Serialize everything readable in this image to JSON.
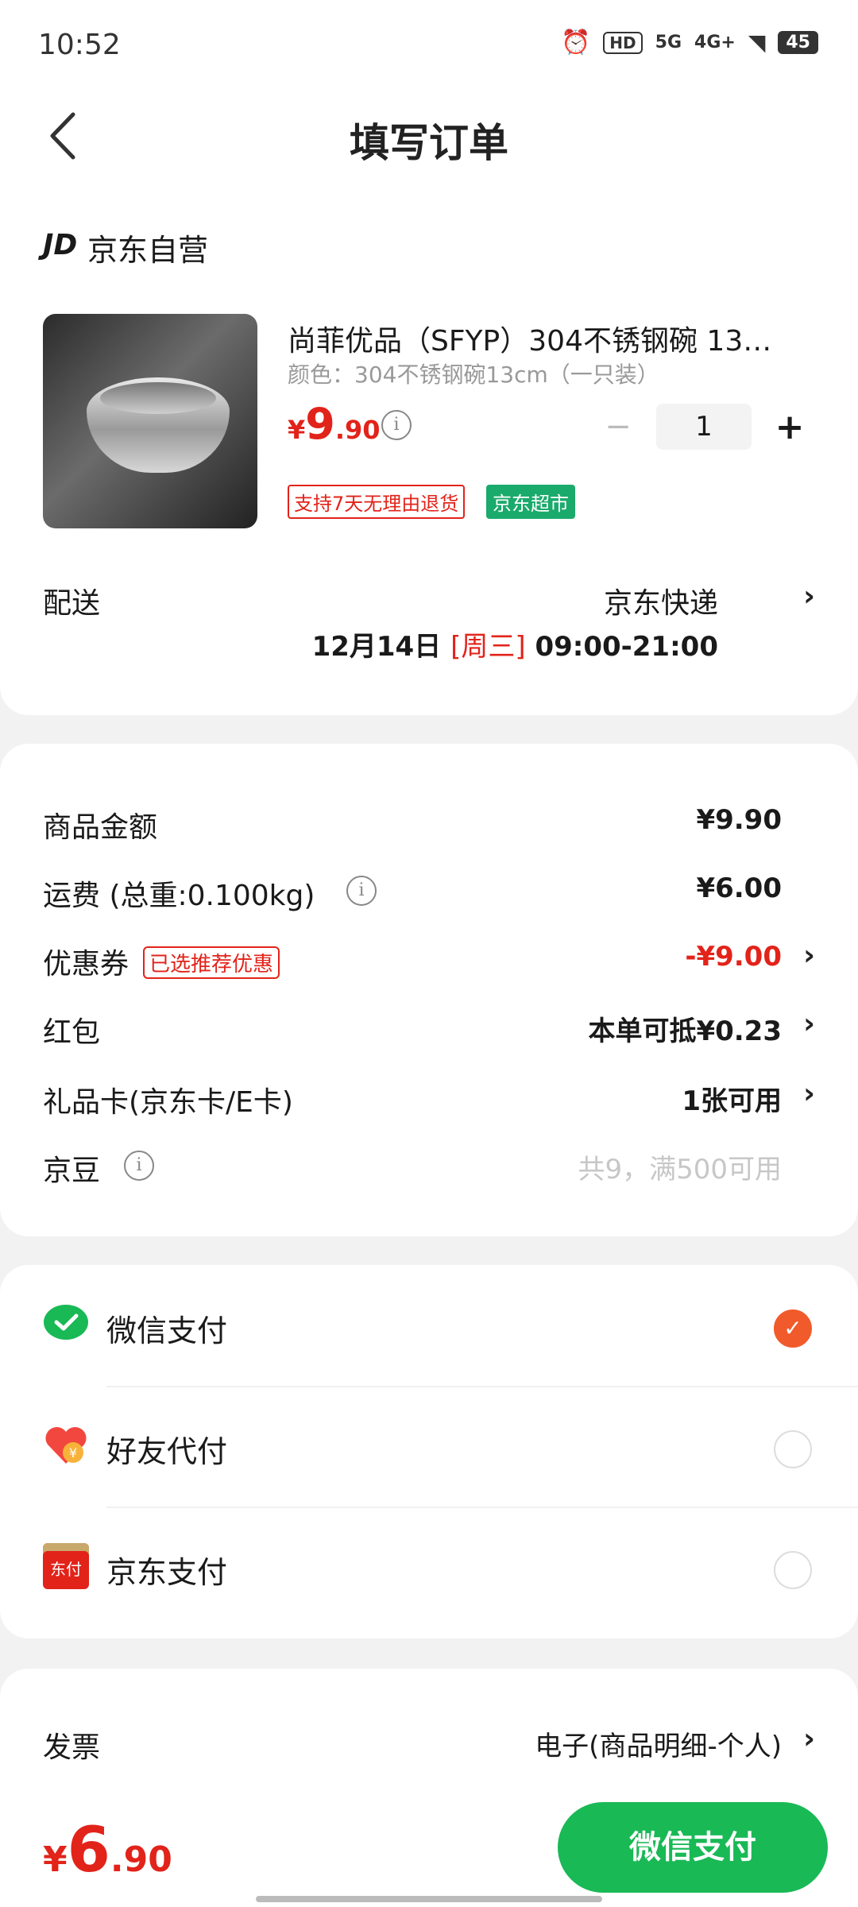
{
  "status_bar": {
    "time": "10:52",
    "hd": "HD",
    "sig1": "5G",
    "sig2": "4G+",
    "battery": "45"
  },
  "header": {
    "title": "填写订单"
  },
  "store": {
    "logo": "JD",
    "name": "京东自营"
  },
  "product": {
    "name": "尚菲优品（SFYP）304不锈钢碗 13…",
    "spec": "颜色：304不锈钢碗13cm（一只装）",
    "price_symbol": "¥",
    "price_int": "9",
    "price_dec": ".90",
    "quantity": "1",
    "minus": "−",
    "plus": "+",
    "tags": [
      "支持7天无理由退货",
      "京东超市"
    ]
  },
  "shipping": {
    "label": "配送",
    "company": "京东快递",
    "date": "12月14日",
    "weekday": "[周三]",
    "time": "09:00-21:00"
  },
  "summary": [
    {
      "label": "商品金额",
      "value": "¥9.90"
    },
    {
      "label": "运费  (总重:0.100kg)",
      "value": "¥6.00"
    },
    {
      "label": "优惠券",
      "tag": "已选推荐优惠",
      "value": "-¥9.00"
    },
    {
      "label": "红包",
      "value": "本单可抵¥0.23"
    },
    {
      "label": "礼品卡(京东卡/E卡)",
      "value": "1张可用"
    },
    {
      "label": "京豆",
      "value": "共9，满500可用"
    }
  ],
  "payment": {
    "options": [
      {
        "label": "微信支付",
        "selected": true
      },
      {
        "label": "好友代付",
        "selected": false
      },
      {
        "label": "京东支付",
        "selected": false
      }
    ],
    "jdpay_icon_text": "东付"
  },
  "invoice": {
    "label": "发票",
    "value": "电子(商品明细-个人)"
  },
  "footer": {
    "total_symbol": "¥",
    "total_int": "6",
    "total_dec": ".90",
    "pay_button": "微信支付"
  },
  "icons": {
    "back": "chevron-left-icon",
    "info": "info-icon",
    "chevron": "chevron-right-icon"
  },
  "colors": {
    "accent_red": "#e2231a",
    "wechat_green": "#19b955",
    "selected_orange": "#f15a2b"
  }
}
